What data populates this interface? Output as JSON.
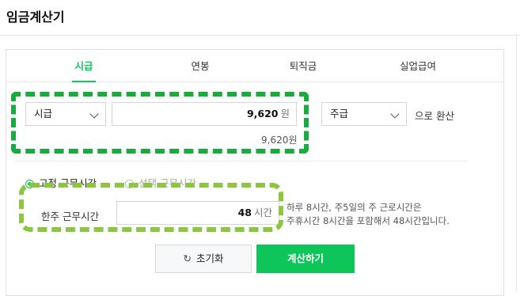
{
  "page": {
    "title": "임금계산기"
  },
  "tabs": [
    {
      "label": "시급",
      "active": true
    },
    {
      "label": "연봉",
      "active": false
    },
    {
      "label": "퇴직금",
      "active": false
    },
    {
      "label": "실업급여",
      "active": false
    }
  ],
  "conversion": {
    "from_unit": "시급",
    "amount": "9,620",
    "currency_unit": "원",
    "amount_display": "9,620원",
    "to_unit": "주급",
    "suffix": "으로 환산"
  },
  "work_hours": {
    "options": [
      {
        "label": "고정 근무시간",
        "checked": true
      },
      {
        "label": "선택 근무시간",
        "checked": false
      }
    ],
    "field_label": "한주 근무시간",
    "value": "48",
    "unit": "시간",
    "hint_line1": "하루 8시간, 주5일의 주 근로시간은",
    "hint_line2": "주휴시간 8시간을 포함해서 48시간입니다."
  },
  "actions": {
    "reset_icon": "refresh-icon",
    "reset_label": "초기화",
    "calculate_label": "계산하기"
  },
  "colors": {
    "accent": "#0ec55a",
    "highlight_dark": "#1aaa3e",
    "highlight_light": "#8cc63f"
  }
}
